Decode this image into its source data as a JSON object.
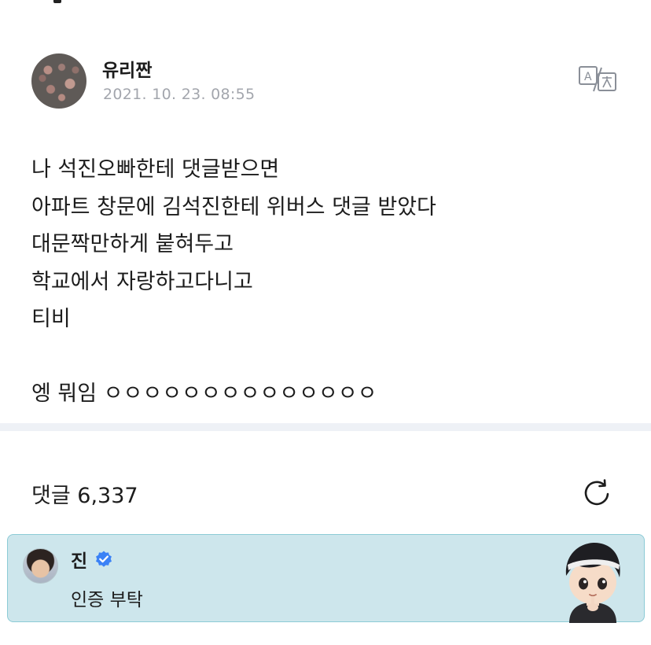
{
  "post": {
    "author": "유리짠",
    "timestamp": "2021. 10. 23. 08:55",
    "body_lines": [
      "나 석진오빠한테 댓글받으면",
      "아파트 창문에 김석진한테 위버스 댓글 받았다",
      "대문짝만하게 붙혀두고",
      "학교에서 자랑하고다니고",
      "티비",
      "",
      "엥 뭐임 ㅇㅇㅇㅇㅇㅇㅇㅇㅇㅇㅇㅇㅇㅇ"
    ]
  },
  "comments": {
    "label": "댓글 6,337"
  },
  "pinned_comment": {
    "author": "진",
    "text": "인증 부탁"
  },
  "icons": {
    "translate": "translate-icon",
    "refresh": "refresh-icon",
    "verified": "verified-badge-icon"
  },
  "colors": {
    "timestamp": "#a3a6ad",
    "divider": "#eef1f6",
    "comment_bg": "#cde6ec",
    "comment_border": "#8ccbd6",
    "verified_blue": "#3b82f6"
  }
}
